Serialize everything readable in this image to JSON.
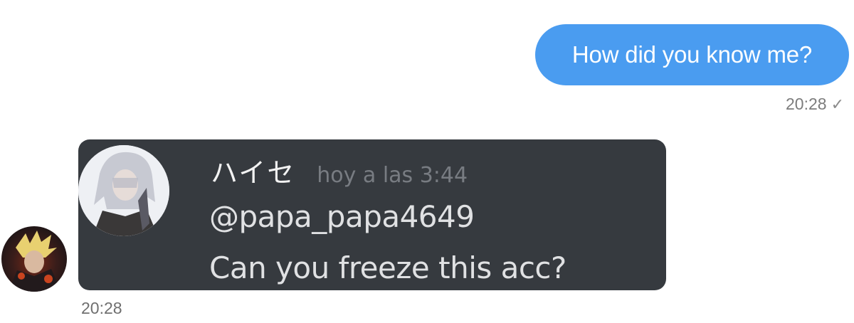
{
  "conversation": {
    "outgoing": {
      "text": "How did you know me?",
      "time": "20:28",
      "status_icon": "check-icon",
      "bubble_color": "#4a9cf0"
    },
    "incoming": {
      "sender_avatar_icon": "user-avatar",
      "time": "20:28",
      "screenshot": {
        "author": "ハイセ",
        "timestamp": "hoy a las 3:44",
        "lines": [
          "@papa_papa4649",
          "Can you freeze this acc?"
        ],
        "background_color": "#363a3f"
      }
    }
  }
}
